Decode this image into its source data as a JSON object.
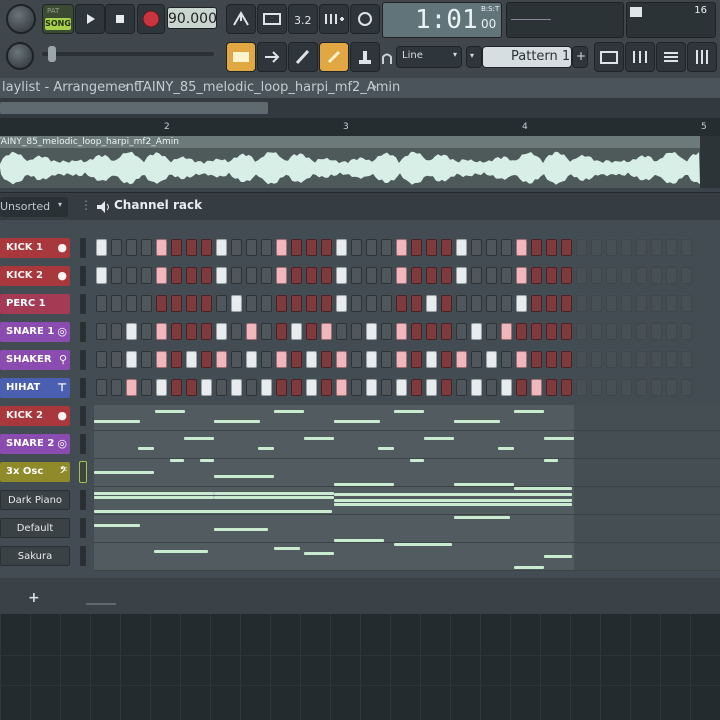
{
  "toolbar": {
    "pat_label": "PAT",
    "song_label": "SONG",
    "tempo": "90.000",
    "time": "1:01",
    "time_frac": "00",
    "time_unit": "B:S:T",
    "cpu_value": "16",
    "snap_mode": "Line",
    "pattern": "Pattern 1",
    "add_symbol": "+"
  },
  "playlist": {
    "title": "laylist - Arrangement",
    "separator": "›",
    "clip_name": "TAINY_85_melodic_loop_harpi_mf2_Amin",
    "ruler": [
      "2",
      "3",
      "4",
      "5"
    ],
    "clip_label": "TAINY_85_melodic_loop_harpi_mf2_Amin"
  },
  "rack": {
    "filter": "Unsorted",
    "title": "Channel rack",
    "add_channel": "+"
  },
  "channels": [
    {
      "name": "KICK 1",
      "style": "ch-red",
      "icon": "kick-drum-icon",
      "pattern": "w...p...w...p...w...p...w...p..."
    },
    {
      "name": "KICK 2",
      "style": "ch-red",
      "icon": "kick-drum-icon",
      "pattern": "w...p...w...p...w...p...w...p..."
    },
    {
      "name": "PERC 1",
      "style": "ch-pink",
      "icon": "",
      "pattern": ".........w......w.....w.....w..."
    },
    {
      "name": "SNARE 1",
      "style": "ch-purple",
      "icon": "drum-icon",
      "pattern": "..w.p...w.p..w.p..w.p....w.p..."
    },
    {
      "name": "SHAKER",
      "style": "ch-purple",
      "icon": "maraca-icon",
      "pattern": "..w.p.w.p.w.p.w.p.w.p.w.p.w.p..."
    },
    {
      "name": "HIHAT",
      "style": "ch-blue",
      "icon": "hihat-icon",
      "pattern": "..p.w..w.w.w..w.p.w.w.w..w.w.p.."
    },
    {
      "name": "KICK 2",
      "style": "ch-red",
      "icon": "kick-drum-icon",
      "pattern": ""
    },
    {
      "name": "SNARE 2",
      "style": "ch-purple",
      "icon": "drum-icon",
      "pattern": ""
    },
    {
      "name": "3x Osc",
      "style": "ch-olive",
      "icon": "bass-clef-icon",
      "pattern": ""
    },
    {
      "name": "Dark Piano",
      "style": "ch-gray",
      "icon": "",
      "pattern": ""
    },
    {
      "name": "Default",
      "style": "ch-gray",
      "icon": "",
      "pattern": ""
    },
    {
      "name": "Sakura",
      "style": "ch-gray",
      "icon": "",
      "pattern": ""
    }
  ]
}
